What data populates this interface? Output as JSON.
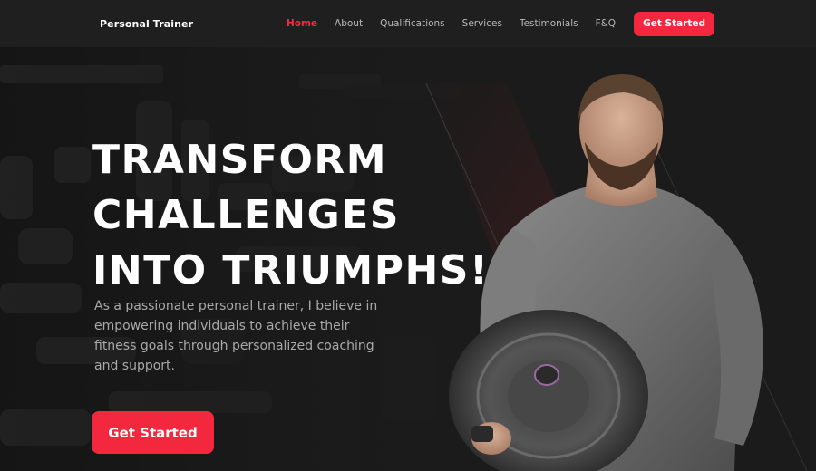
{
  "nav": {
    "brand": "Personal Trainer",
    "links": [
      "Home",
      "About",
      "Qualifications",
      "Services",
      "Testimonials",
      "F&Q"
    ],
    "active_link": "Home",
    "cta_label": "Get Started"
  },
  "hero": {
    "title_lines": [
      "TRANSFORM",
      "CHALLENGES",
      "INTO TRIUMPHS!"
    ],
    "description": "As a passionate personal trainer, I believe in empowering individuals to achieve their fitness goals through personalized coaching and support.",
    "cta_label": "Get Started"
  },
  "colors": {
    "accent": "#f3273d",
    "nav_background": "#1f1f1f",
    "hero_background": "#1a1a1a",
    "muted_text": "#a9a9a9"
  },
  "images": {
    "hero_background": "gym-background-image",
    "trainer": "trainer-holding-weight-plate-photo"
  }
}
